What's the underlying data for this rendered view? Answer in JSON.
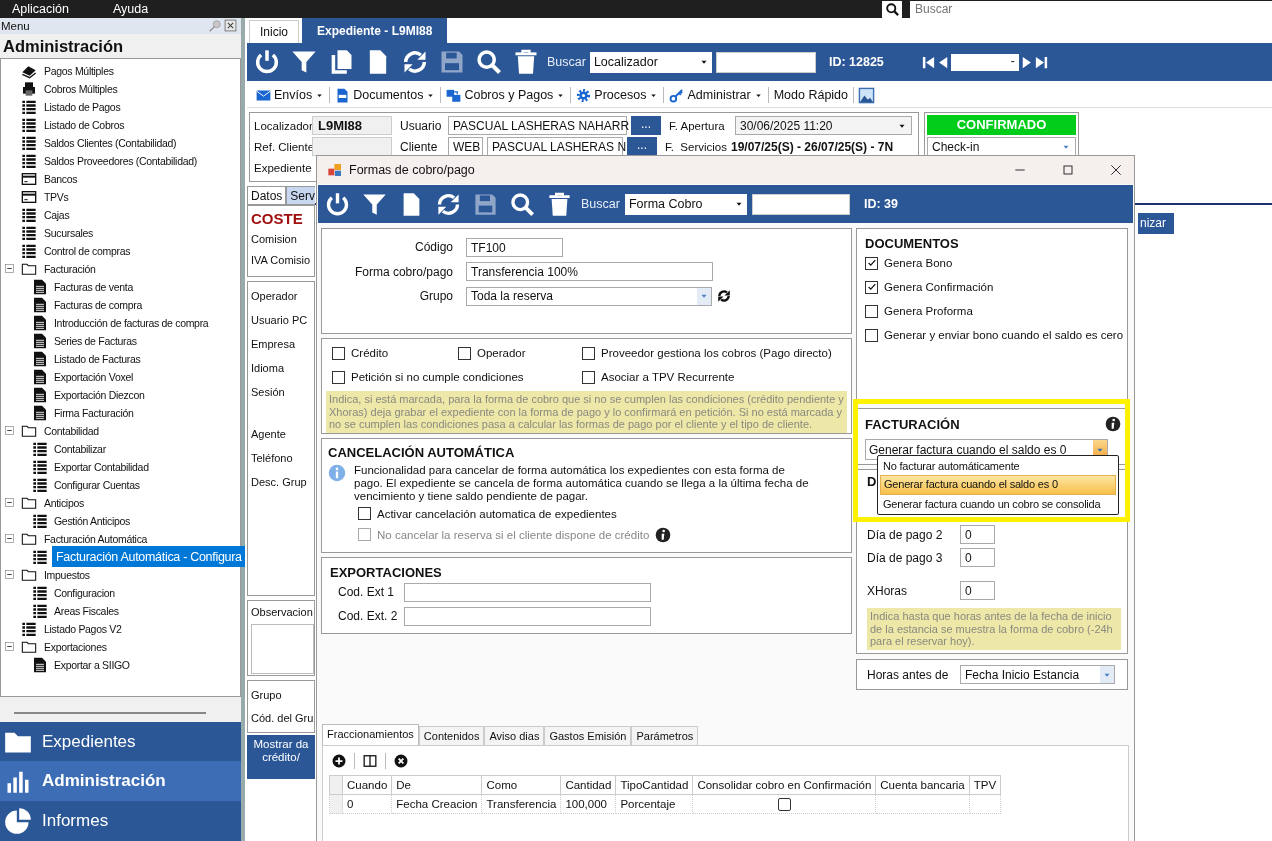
{
  "menubar": {
    "items": [
      "Aplicación",
      "Ayuda"
    ],
    "search": {
      "placeholder": "Buscar"
    }
  },
  "sidebar": {
    "header": "Menu",
    "title": "Administración",
    "tree": [
      {
        "label": "Pagos Múltiples",
        "kind": "hand",
        "selected": false
      },
      {
        "label": "Cobros Múltiples",
        "kind": "printer",
        "selected": false
      },
      {
        "label": "Listado de Pagos",
        "kind": "list",
        "selected": false
      },
      {
        "label": "Listado de Cobros",
        "kind": "list",
        "selected": false
      },
      {
        "label": "Saldos Clientes (Contabilidad)",
        "kind": "list",
        "selected": false
      },
      {
        "label": "Saldos Proveedores (Contabilidad)",
        "kind": "list",
        "selected": false
      },
      {
        "label": "Bancos",
        "kind": "card",
        "selected": false
      },
      {
        "label": "TPVs",
        "kind": "card",
        "selected": false
      },
      {
        "label": "Cajas",
        "kind": "list",
        "selected": false
      },
      {
        "label": "Sucursales",
        "kind": "list",
        "selected": false
      },
      {
        "label": "Control de compras",
        "kind": "list",
        "selected": false
      },
      {
        "label": "Facturación",
        "kind": "folder",
        "selected": false,
        "expanded": true,
        "children": [
          {
            "label": "Facturas de venta",
            "kind": "invoice",
            "selected": false
          },
          {
            "label": "Facturas de compra",
            "kind": "invoice",
            "selected": false
          },
          {
            "label": "Introducción de facturas de compra",
            "kind": "invoice",
            "selected": false
          },
          {
            "label": "Series de Facturas",
            "kind": "invoice",
            "selected": false
          },
          {
            "label": "Listado de Facturas",
            "kind": "invoice",
            "selected": false
          },
          {
            "label": "Exportación Voxel",
            "kind": "invoice",
            "selected": false
          },
          {
            "label": "Exportación Diezcon",
            "kind": "invoice",
            "selected": false
          },
          {
            "label": "Firma Facturación",
            "kind": "invoice",
            "selected": false
          }
        ]
      },
      {
        "label": "Contabilidad",
        "kind": "folder",
        "selected": false,
        "expanded": true,
        "children": [
          {
            "label": "Contabilizar",
            "kind": "list",
            "selected": false
          },
          {
            "label": "Exportar Contabilidad",
            "kind": "list",
            "selected": false
          },
          {
            "label": "Configurar Cuentas",
            "kind": "list",
            "selected": false
          }
        ]
      },
      {
        "label": "Anticipos",
        "kind": "folder",
        "selected": false,
        "expanded": true,
        "children": [
          {
            "label": "Gestión Anticipos",
            "kind": "list",
            "selected": false
          }
        ]
      },
      {
        "label": "Facturación Automática",
        "kind": "folder",
        "selected": false,
        "expanded": true,
        "children": [
          {
            "label": "Facturación Automática - Configura",
            "kind": "list",
            "selected": true
          }
        ]
      },
      {
        "label": "Impuestos",
        "kind": "folder",
        "selected": false,
        "expanded": true,
        "children": [
          {
            "label": "Configuracion",
            "kind": "list",
            "selected": false
          },
          {
            "label": "Areas Fiscales",
            "kind": "list",
            "selected": false
          }
        ]
      },
      {
        "label": "Listado Pagos V2",
        "kind": "list",
        "selected": false
      },
      {
        "label": "Exportaciones",
        "kind": "folder",
        "selected": false,
        "expanded": true,
        "children": [
          {
            "label": "Exportar a SIIGO",
            "kind": "invoice",
            "selected": false
          }
        ]
      }
    ],
    "nav": [
      {
        "label": "Expedientes",
        "kind": "folder",
        "selected": false
      },
      {
        "label": "Administración",
        "kind": "chart",
        "selected": true
      },
      {
        "label": "Informes",
        "kind": "pie",
        "selected": false
      }
    ]
  },
  "main": {
    "tabs": [
      {
        "label": "Inicio",
        "selected": false
      },
      {
        "label": "Expediente  - L9MI88",
        "selected": true
      }
    ],
    "toolbar": {
      "buttons": [
        {
          "kind": "power",
          "disabled": false
        },
        {
          "kind": "filter",
          "disabled": false
        },
        {
          "kind": "copy",
          "disabled": false
        },
        {
          "kind": "doc",
          "disabled": false
        },
        {
          "kind": "refresh",
          "disabled": false
        },
        {
          "kind": "save",
          "disabled": true
        },
        {
          "kind": "search",
          "disabled": false
        },
        {
          "kind": "trash",
          "disabled": false
        }
      ],
      "search_label": "Buscar",
      "search_by": "Localizador",
      "id": "ID: 12825",
      "record": "-"
    },
    "menu_toolbar": [
      {
        "label": "Envíos",
        "kind": "mail",
        "dropdown": true
      },
      {
        "label": "Documentos",
        "kind": "pdf",
        "dropdown": true
      },
      {
        "label": "Cobros y Pagos",
        "kind": "money",
        "dropdown": true
      },
      {
        "label": "Procesos",
        "kind": "gear",
        "dropdown": true
      },
      {
        "label": "Administrar",
        "kind": "key",
        "dropdown": true
      },
      {
        "label": "Modo Rápido",
        "kind": "plain",
        "dropdown": false
      }
    ],
    "header": {
      "localizador": {
        "label": "Localizador",
        "value": "L9MI88"
      },
      "usuario": {
        "label": "Usuario",
        "value": "PASCUAL LASHERAS NAHARR",
        "button": "..."
      },
      "apertura": {
        "label": "F. Apertura",
        "value": "30/06/2025 11:20"
      },
      "status": "CONFIRMADO",
      "stage": "Check-in",
      "ref_cliente": {
        "label": "Ref. Cliente"
      },
      "cliente": {
        "label": "Cliente",
        "channel": "WEB",
        "value": "PASCUAL LASHERAS N",
        "button": "..."
      },
      "servicios": {
        "label": "F.  Servicios",
        "value": "19/07/25(S) - 26/07/25(S) - 7N"
      },
      "expediente": {
        "label": "Expediente"
      }
    },
    "side": {
      "tabs": [
        {
          "label": "Datos",
          "selected": true
        },
        {
          "label": "Serv",
          "selected": false
        }
      ],
      "coste": "COSTE",
      "coste_labels": [
        "Comision",
        "IVA Comisio"
      ],
      "labels": [
        "Operador",
        "Usuario PC",
        "Empresa",
        "Idioma",
        "Sesión"
      ],
      "labels2": [
        "Agente",
        "Teléfono",
        "Desc. Grup"
      ],
      "observaciones": "Observacion",
      "group_labels": [
        "Grupo",
        "Cód. del Gru"
      ],
      "button": "Mostrar da\ncrédito/"
    },
    "right_button": "nizar"
  },
  "dialog": {
    "title": "Formas de cobro/pago",
    "toolbar": {
      "buttons": [
        {
          "kind": "power",
          "disabled": false
        },
        {
          "kind": "filter",
          "disabled": false
        },
        {
          "kind": "doc",
          "disabled": false
        },
        {
          "kind": "refresh",
          "disabled": false
        },
        {
          "kind": "save",
          "disabled": true
        },
        {
          "kind": "search",
          "disabled": false
        },
        {
          "kind": "trash",
          "disabled": false
        }
      ],
      "search_label": "Buscar",
      "search_by": "Forma Cobro",
      "id": "ID: 39"
    },
    "general": [
      {
        "label": "Código",
        "value": "TF100",
        "kind": "short"
      },
      {
        "label": "Forma cobro/pago",
        "value": "Transferencia 100%",
        "kind": "text"
      },
      {
        "label": "Grupo",
        "value": "Toda la reserva",
        "kind": "select"
      }
    ],
    "options": [
      {
        "label": "Crédito",
        "checked": false
      },
      {
        "label": "Operador",
        "checked": false
      },
      {
        "label": "Proveedor gestiona los cobros (Pago directo)",
        "checked": false
      },
      {
        "label": "Petición si no cumple condiciones",
        "checked": false
      },
      {
        "label": "Asociar a TPV Recurrente",
        "checked": false
      }
    ],
    "options_note": "Indica, si está marcada, para la forma de cobro que si no se cumplen las condiciones (crédito pendiente y Xhoras) deja grabar el expediente con la forma de pago y lo confirmará en petición. Si no está marcada y no se cumplen las condiciones pasa a calcular las formas de pago por el cliente y el tipo de cliente.",
    "cancelacion": {
      "title": "CANCELACIÓN AUTOMÁTICA",
      "text": "Funcionalidad para cancelar de forma automática los expedientes con esta forma de pago. El expediente se cancela de forma automática cuando se llega a la última fecha de vencimiento y tiene saldo pendiente de pagar.",
      "checks": [
        {
          "label": "Activar cancelación automatica de expedientes",
          "checked": false,
          "disabled": false
        },
        {
          "label": "No cancelar la reserva si el cliente dispone de crédito",
          "checked": false,
          "disabled": true
        }
      ]
    },
    "exportaciones": {
      "title": "EXPORTACIONES",
      "fields": [
        {
          "label": "Cod. Ext 1"
        },
        {
          "label": "Cod. Ext. 2"
        }
      ]
    },
    "documentos": {
      "title": "DOCUMENTOS",
      "checks": [
        {
          "label": "Genera Bono",
          "checked": true
        },
        {
          "label": "Genera Confirmación",
          "checked": true
        },
        {
          "label": "Genera Proforma",
          "checked": false
        },
        {
          "label": "Generar y enviar bono cuando el saldo es cero",
          "checked": false
        }
      ]
    },
    "facturacion": {
      "title": "FACTURACIÓN",
      "value": "Generar factura cuando el saldo es 0",
      "expanded": true,
      "highlighted": true,
      "options": [
        {
          "label": "No facturar automáticamente",
          "selected": false
        },
        {
          "label": "Generar factura cuando el saldo es 0",
          "selected": true
        },
        {
          "label": "Generar factura cuando un cobro se consolida",
          "selected": false
        }
      ]
    },
    "dias": {
      "title": "D",
      "fields": [
        {
          "label": "Día de pago 2",
          "value": "0"
        },
        {
          "label": "Día de pago 3",
          "value": "0"
        },
        {
          "label": "XHoras",
          "value": "0"
        }
      ],
      "note": "Indica hasta que horas antes de la fecha de inicio de la estancia se muestra la forma de cobro (-24h para el reservar hoy)."
    },
    "horas": {
      "label": "Horas antes de",
      "value": "Fecha Inicio Estancia"
    },
    "tabs": [
      {
        "label": "Fraccionamientos",
        "selected": true
      },
      {
        "label": "Contenidos",
        "selected": false
      },
      {
        "label": "Aviso dias",
        "selected": false
      },
      {
        "label": "Gastos Emisión",
        "selected": false
      },
      {
        "label": "Parámetros",
        "selected": false
      }
    ],
    "grid": {
      "columns": [
        "Cuando",
        "De",
        "Como",
        "Cantidad",
        "TipoCantidad",
        "Consolidar cobro en Confirmación",
        "Cuenta bancaria",
        "TPV"
      ],
      "rows": [
        {
          "cuando": "0",
          "de": "Fecha Creacion",
          "como": "Transferencia",
          "cantidad": "100,000",
          "tipo_cantidad": "Porcentaje",
          "consolidar": false
        }
      ]
    }
  }
}
